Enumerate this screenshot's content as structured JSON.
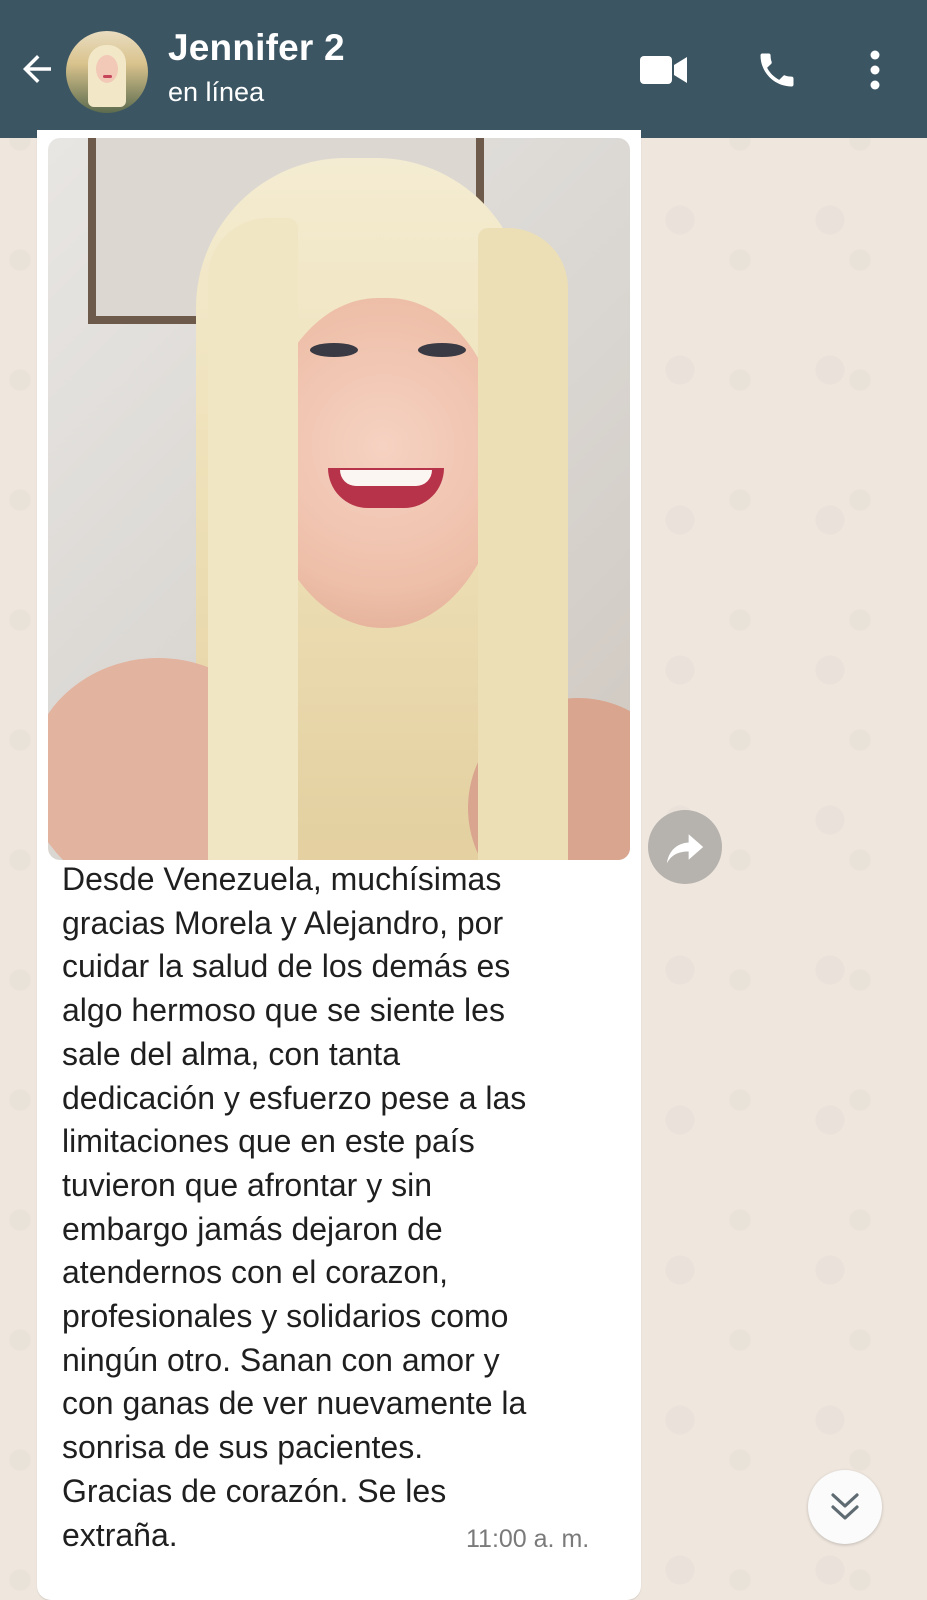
{
  "header": {
    "contact_name": "Jennifer 2",
    "status": "en línea",
    "background_color": "#3b5563",
    "icons": [
      "arrow-back-icon",
      "video-call-icon",
      "phone-call-icon",
      "more-options-icon"
    ]
  },
  "chat": {
    "message": {
      "text": "Desde Venezuela, muchísimas\ngracias Morela y Alejandro, por\ncuidar la salud de los demás es\nalgo hermoso que se siente les\nsale del alma, con tanta\ndedicación y esfuerzo pese a las\nlimitaciones que en este país\ntuvieron que afrontar y sin\nembargo jamás dejaron de\natendernos con el corazon,\nprofesionales y solidarios como\nningún otro. Sanan con amor y\ncon ganas de ver nuevamente la\nsonrisa de sus pacientes.\nGracias de corazón. Se les\nextraña.",
      "time": "11:00 a. m.",
      "has_photo": true
    },
    "forward_icon": "forward-arrow-icon",
    "scroll_down_icon": "double-chevron-down-icon"
  }
}
